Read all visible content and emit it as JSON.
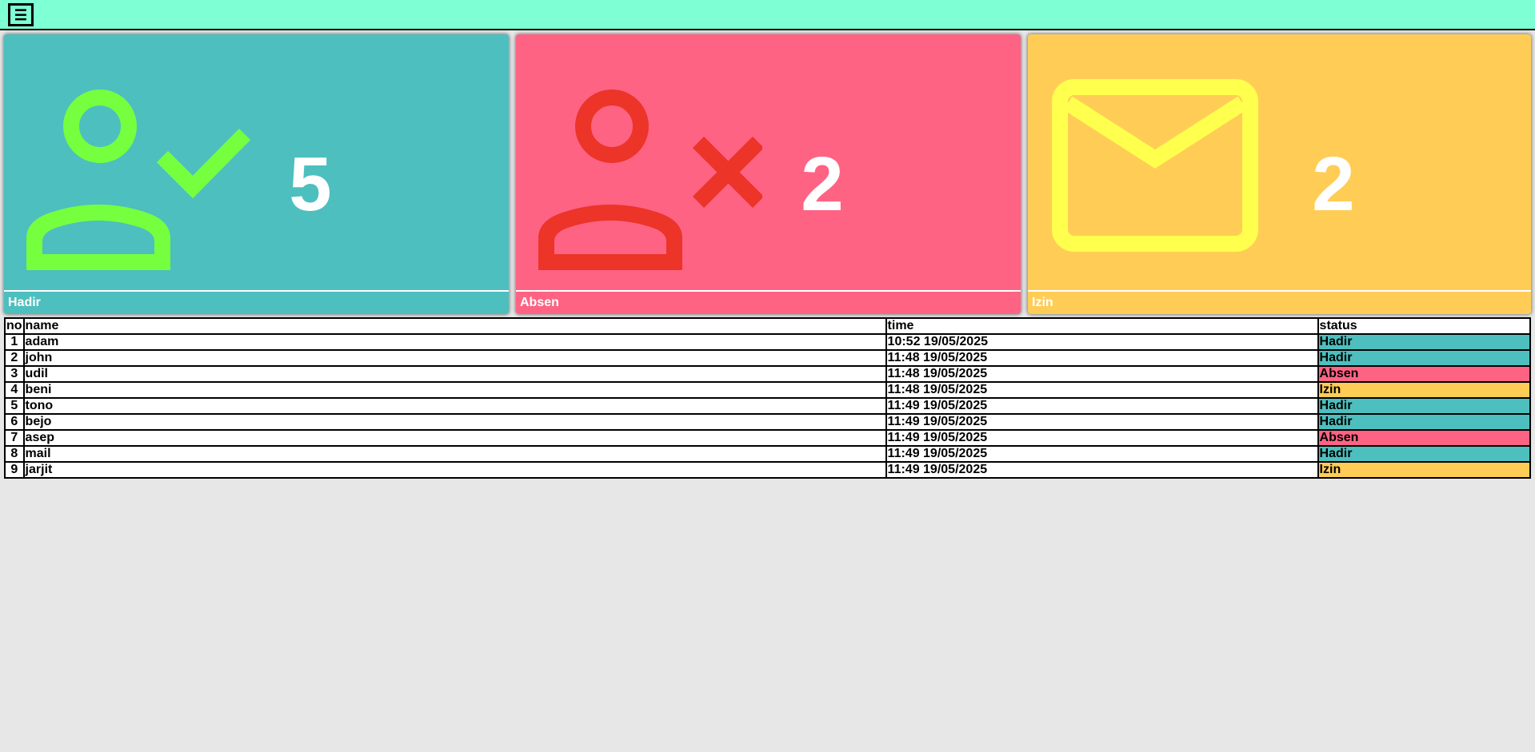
{
  "header": {
    "menu_icon": "hamburger-icon",
    "menu_label": "☰"
  },
  "cards": [
    {
      "label": "Hadir",
      "count": "5",
      "color": "#4dbfbf",
      "icon": "person-check-icon",
      "icon_color": "#76ff3f"
    },
    {
      "label": "Absen",
      "count": "2",
      "color": "#ff6384",
      "icon": "person-x-icon",
      "icon_color": "#ec3428"
    },
    {
      "label": "Izin",
      "count": "2",
      "color": "#ffcd56",
      "icon": "envelope-icon",
      "icon_color": "#ffff4d"
    }
  ],
  "table": {
    "headers": [
      "no",
      "name",
      "time",
      "status"
    ],
    "rows": [
      [
        "1",
        "adam",
        "10:52 19/05/2025",
        "Hadir"
      ],
      [
        "2",
        "john",
        "11:48 19/05/2025",
        "Hadir"
      ],
      [
        "3",
        "udil",
        "11:48 19/05/2025",
        "Absen"
      ],
      [
        "4",
        "beni",
        "11:48 19/05/2025",
        "Izin"
      ],
      [
        "5",
        "tono",
        "11:49 19/05/2025",
        "Hadir"
      ],
      [
        "6",
        "bejo",
        "11:49 19/05/2025",
        "Hadir"
      ],
      [
        "7",
        "asep",
        "11:49 19/05/2025",
        "Absen"
      ],
      [
        "8",
        "mail",
        "11:49 19/05/2025",
        "Hadir"
      ],
      [
        "9",
        "jarjit",
        "11:49 19/05/2025",
        "Izin"
      ]
    ]
  },
  "status_colors": {
    "Hadir": "#4dbfbf",
    "Absen": "#ff6384",
    "Izin": "#ffcd56"
  }
}
